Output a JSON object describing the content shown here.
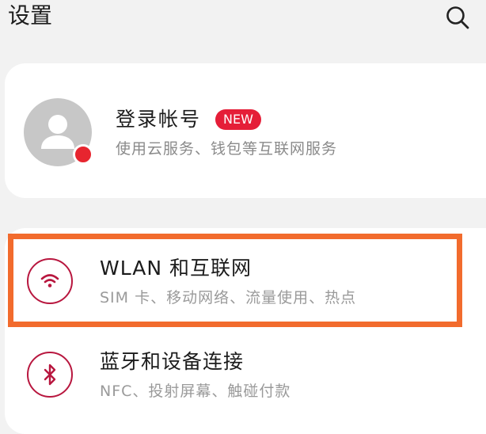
{
  "header": {
    "title": "设置",
    "search_icon": "search-icon"
  },
  "account": {
    "title": "登录帐号",
    "badge": "NEW",
    "subtitle": "使用云服务、钱包等互联网服务",
    "avatar_icon": "person-icon",
    "notification_color": "#e7252f"
  },
  "items": [
    {
      "icon": "wifi-icon",
      "title": "WLAN 和互联网",
      "subtitle": "SIM 卡、移动网络、流量使用、热点",
      "highlighted": true
    },
    {
      "icon": "bluetooth-icon",
      "title": "蓝牙和设备连接",
      "subtitle": "NFC、投射屏幕、触碰付款"
    }
  ],
  "colors": {
    "accent": "#b8173f",
    "badge": "#e51e38",
    "highlight_border": "#f26b2d",
    "background": "#f2f2f2"
  }
}
